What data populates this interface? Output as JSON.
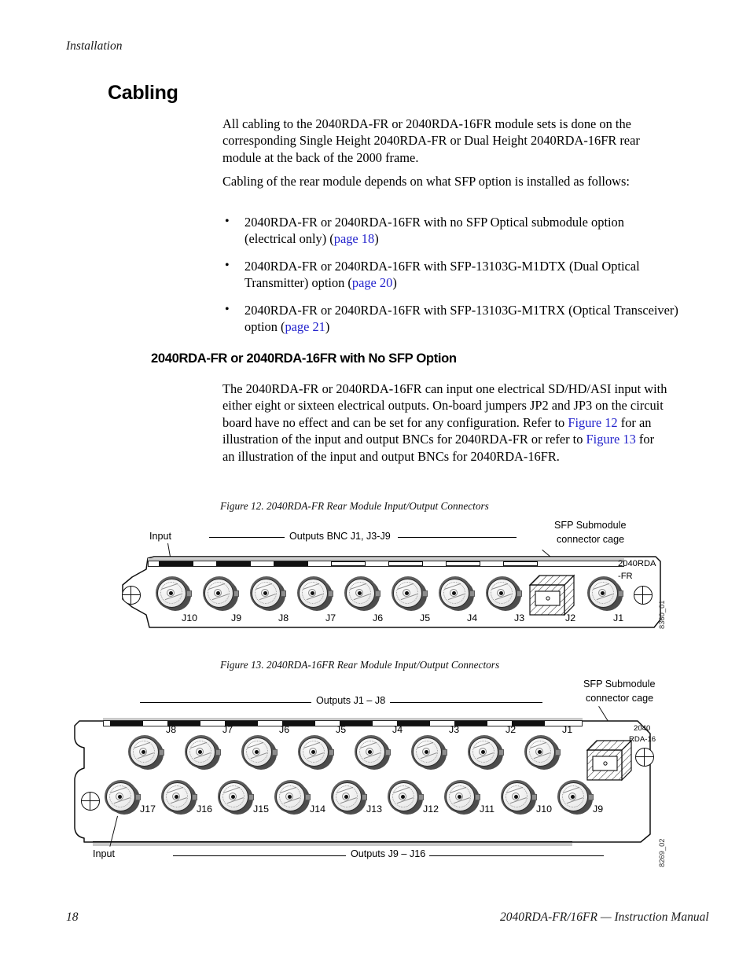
{
  "running_head": "Installation",
  "heading": "Cabling",
  "paragraphs": {
    "intro": "All cabling to the 2040RDA-FR or 2040RDA-16FR module sets is done on the corresponding Single Height 2040RDA-FR or Dual Height 2040RDA-16FR rear module at the back of the 2000 frame.",
    "depends": "Cabling of the rear module depends on what SFP option is installed as follows:"
  },
  "bullets": [
    {
      "pre": "2040RDA-FR or 2040RDA-16FR with no SFP Optical submodule option (electrical only) (",
      "link": "page 18",
      "post": ")"
    },
    {
      "pre": "2040RDA-FR or 2040RDA-16FR with SFP-13103G-M1DTX (Dual Optical Transmitter) option (",
      "link": "page 20",
      "post": ")"
    },
    {
      "pre": "2040RDA-FR or 2040RDA-16FR with SFP-13103G-M1TRX (Optical Transceiver) option (",
      "link": "page 21",
      "post": ")"
    }
  ],
  "section": {
    "heading": "2040RDA-FR or 2040RDA-16FR with No SFP Option",
    "body_1": "The 2040RDA-FR or 2040RDA-16FR can input one electrical SD/HD/ASI input with either eight or sixteen electrical outputs. On-board jumpers JP2 and JP3 on the circuit board have no effect and can be set for any configuration. Refer to ",
    "link_1": "Figure 12",
    "body_2": " for an illustration of the input and output BNCs for 2040RDA-FR or refer to ",
    "link_2": "Figure 13",
    "body_3": " for an illustration of the input and output BNCs for 2040RDA-16FR."
  },
  "figure_12": {
    "caption": "Figure 12.  2040RDA-FR Rear Module Input/Output Connectors",
    "input_label": "Input",
    "outputs_label": "Outputs BNC J1, J3-J9",
    "sfp_label_line1": "SFP Submodule",
    "sfp_label_line2": "connector cage",
    "module_name_line1": "2040RDA",
    "module_name_line2": "-FR",
    "figure_id": "8360_01",
    "connectors": [
      "J10",
      "J9",
      "J8",
      "J7",
      "J6",
      "J5",
      "J4",
      "J3"
    ],
    "cage_label": "J2",
    "last_connector": "J1"
  },
  "figure_13": {
    "caption": "Figure 13.  2040RDA-16FR Rear Module Input/Output Connectors",
    "input_label": "Input",
    "outputs_top_label": "Outputs J1 – J8",
    "outputs_bottom_label": "Outputs J9 – J16",
    "sfp_label_line1": "SFP Submodule",
    "sfp_label_line2": "connector cage",
    "module_name_line1": "2040",
    "module_name_line2": "RDA-16",
    "figure_id": "8269_02",
    "top_row": [
      "J8",
      "J7",
      "J6",
      "J5",
      "J4",
      "J3",
      "J2",
      "J1"
    ],
    "bottom_row": [
      "J17",
      "J16",
      "J15",
      "J14",
      "J13",
      "J12",
      "J11",
      "J10",
      "J9"
    ]
  },
  "footer": {
    "page_number": "18",
    "manual_title": "2040RDA-FR/16FR — Instruction Manual"
  },
  "colors": {
    "link": "#2222cc",
    "text": "#000000"
  }
}
